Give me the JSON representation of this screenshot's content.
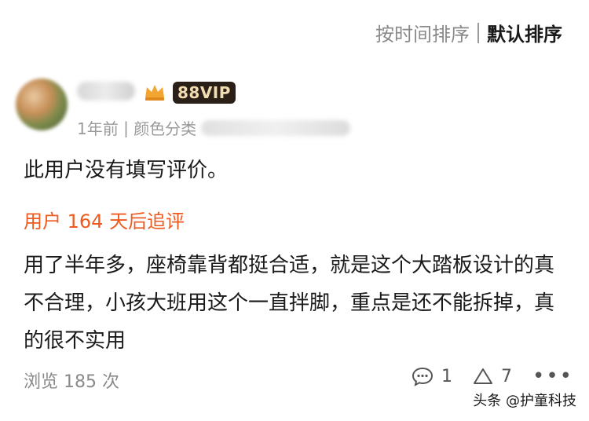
{
  "sort": {
    "time_label": "按时间排序",
    "default_label": "默认排序"
  },
  "user": {
    "vip_badge": "88VIP"
  },
  "meta": {
    "time_ago": "1年前",
    "separator": " | ",
    "variant_prefix": "颜色分类"
  },
  "review": {
    "text": "此用户没有填写评价。"
  },
  "followup": {
    "label": "用户 164 天后追评",
    "text": "用了半年多，座椅靠背都挺合适，就是这个大踏板设计的真不合理，小孩大班用这个一直拌脚，重点是还不能拆掉，真的很不实用"
  },
  "stats": {
    "views": "浏览 185 次",
    "comments": "1",
    "likes": "7"
  },
  "watermark": "头条 @护童科技",
  "colors": {
    "accent": "#ee5a1f",
    "vip_bg": "#2b2017",
    "vip_text": "#f3dcb1"
  }
}
